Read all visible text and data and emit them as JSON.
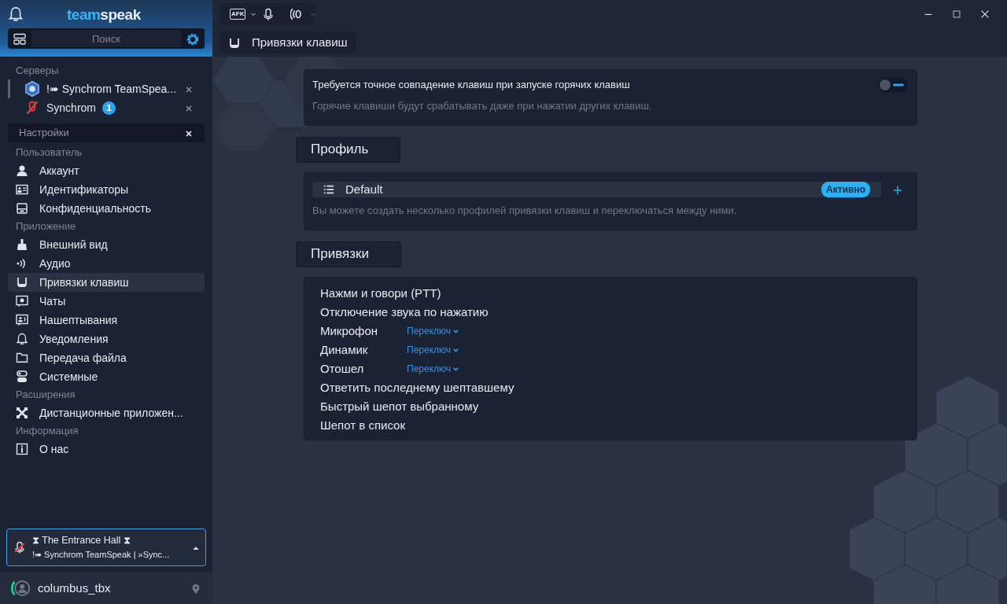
{
  "app": {
    "logo": [
      "team",
      "speak"
    ],
    "search": {
      "placeholder": "Поиск"
    }
  },
  "toolbar": {
    "afk": "AFK"
  },
  "servers": {
    "heading": "Серверы",
    "items": [
      {
        "name": "!➠ Synchrom TeamSpea...",
        "selected": true
      },
      {
        "name": "Synchrom",
        "badge": "1",
        "selected": false
      }
    ]
  },
  "settings_tab": {
    "label": "Настройки"
  },
  "nav": [
    {
      "heading": "Пользователь",
      "items": [
        {
          "label": "Аккаунт",
          "selected": false
        },
        {
          "label": "Идентификаторы",
          "selected": false
        },
        {
          "label": "Конфиденциальность",
          "selected": false
        }
      ]
    },
    {
      "heading": "Приложение",
      "items": [
        {
          "label": "Внешний вид",
          "selected": false
        },
        {
          "label": "Аудио",
          "selected": false
        },
        {
          "label": "Привязки клавиш",
          "selected": true
        },
        {
          "label": "Чаты",
          "selected": false
        },
        {
          "label": "Нашептывания",
          "selected": false
        },
        {
          "label": "Уведомления",
          "selected": false
        },
        {
          "label": "Передача файла",
          "selected": false
        },
        {
          "label": "Системные",
          "selected": false
        }
      ]
    },
    {
      "heading": "Расширения",
      "items": [
        {
          "label": "Дистанционные приложен...",
          "selected": false
        }
      ]
    },
    {
      "heading": "Информация",
      "items": [
        {
          "label": "О нас",
          "selected": false
        }
      ]
    }
  ],
  "connection": {
    "channel": "⧗ The Entrance Hall ⧗",
    "server": "!➠ Synchrom TeamSpeak | »Sync..."
  },
  "user": {
    "name": "columbus_tbx"
  },
  "page": {
    "title": "Привязки клавиш"
  },
  "exact_match": {
    "title": "Требуется точное совпадение клавиш при запуске горячих клавиш",
    "description": "Горячие клавиши будут срабатывать даже при нажатии других клавиш.",
    "on": false
  },
  "profile": {
    "heading": "Профиль",
    "items": [
      {
        "name": "Default",
        "badge": "Активно",
        "selected": true
      }
    ],
    "description": "Вы можете создать несколько профилей привязки клавиш и переключаться между ними."
  },
  "bindings": {
    "heading": "Привязки",
    "items": [
      {
        "label": "Нажми и говори (PTT)"
      },
      {
        "label": "Отключение звука по нажатию"
      },
      {
        "label": "Микрофон",
        "mode": "Переключ"
      },
      {
        "label": "Динамик",
        "mode": "Переключ"
      },
      {
        "label": "Отошел",
        "mode": "Переключ"
      },
      {
        "label": "Ответить последнему шептавшему"
      },
      {
        "label": "Быстрый шепот выбранному"
      },
      {
        "label": "Шепот в список"
      }
    ]
  }
}
